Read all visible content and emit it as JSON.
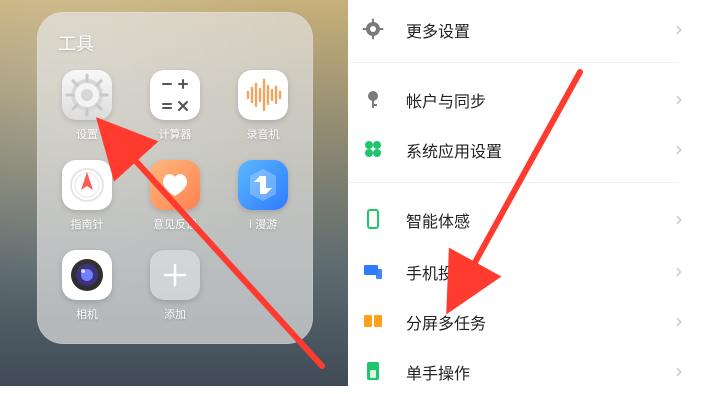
{
  "left": {
    "folder_title": "工具",
    "apps": [
      {
        "label": "设置",
        "icon": "settings-icon"
      },
      {
        "label": "计算器",
        "icon": "calculator-icon"
      },
      {
        "label": "录音机",
        "icon": "recorder-icon"
      },
      {
        "label": "指南针",
        "icon": "compass-icon"
      },
      {
        "label": "意见反馈",
        "icon": "feedback-icon"
      },
      {
        "label": "i 漫游",
        "icon": "roaming-icon"
      },
      {
        "label": "相机",
        "icon": "camera-icon"
      },
      {
        "label": "添加",
        "icon": "add-icon"
      }
    ]
  },
  "right": {
    "items": [
      {
        "label": "更多设置",
        "icon": "gear-icon",
        "color": "#7a7a7a"
      },
      {
        "label": "帐户与同步",
        "icon": "key-icon",
        "color": "#7a7a7a"
      },
      {
        "label": "系统应用设置",
        "icon": "apps-icon",
        "color": "#1fc66b"
      },
      {
        "label": "智能体感",
        "icon": "phone-outline-icon",
        "color": "#1fc66b"
      },
      {
        "label": "手机投屏",
        "icon": "cast-screen-icon",
        "color": "#2f7bff"
      },
      {
        "label": "分屏多任务",
        "icon": "split-screen-icon",
        "color": "#ffa21b"
      },
      {
        "label": "单手操作",
        "icon": "one-hand-icon",
        "color": "#1fc66b"
      }
    ],
    "chevron": "›"
  },
  "colors": {
    "arrow_red": "#ff3b30"
  }
}
